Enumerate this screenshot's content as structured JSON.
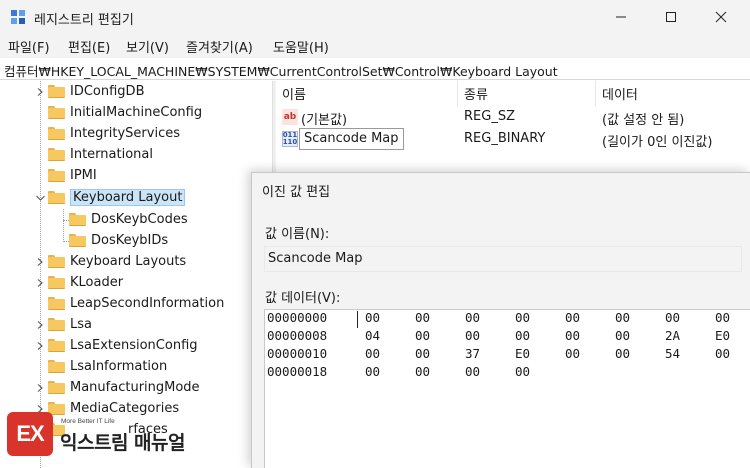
{
  "window": {
    "title": "레지스트리 편집기"
  },
  "menu": [
    "파일(F)",
    "편집(E)",
    "보기(V)",
    "즐겨찾기(A)",
    "도움말(H)"
  ],
  "address": "컴퓨터₩HKEY_LOCAL_MACHINE₩SYSTEM₩CurrentControlSet₩Control₩Keyboard Layout",
  "tree": {
    "items": [
      {
        "label": "IDConfigDB",
        "expandable": true
      },
      {
        "label": "InitialMachineConfig",
        "expandable": false
      },
      {
        "label": "IntegrityServices",
        "expandable": false
      },
      {
        "label": "International",
        "expandable": false
      },
      {
        "label": "IPMI",
        "expandable": false
      },
      {
        "label": "Keyboard Layout",
        "expandable": true,
        "expanded": true,
        "selected": true
      },
      {
        "label": "DosKeybCodes",
        "expandable": false,
        "child": true
      },
      {
        "label": "DosKeybIDs",
        "expandable": false,
        "child": true
      },
      {
        "label": "Keyboard Layouts",
        "expandable": true
      },
      {
        "label": "KLoader",
        "expandable": true
      },
      {
        "label": "LeapSecondInformation",
        "expandable": false
      },
      {
        "label": "Lsa",
        "expandable": true
      },
      {
        "label": "LsaExtensionConfig",
        "expandable": true
      },
      {
        "label": "LsaInformation",
        "expandable": false
      },
      {
        "label": "ManufacturingMode",
        "expandable": true
      },
      {
        "label": "MediaCategories",
        "expandable": true
      },
      {
        "label": "rfaces",
        "expandable": false
      }
    ]
  },
  "list": {
    "columns": [
      "이름",
      "종류",
      "데이터"
    ],
    "rows": [
      {
        "name": "(기본값)",
        "type": "REG_SZ",
        "data": "(값 설정 안 됨)",
        "icon": "string-value-icon"
      },
      {
        "name": "Scancode Map",
        "type": "REG_BINARY",
        "data": "(길이가 0인 이진값)",
        "icon": "binary-value-icon"
      }
    ]
  },
  "dialog": {
    "title": "이진 값 편집",
    "name_label": "값 이름(N):",
    "name_value": "Scancode Map",
    "data_label": "값 데이터(V):",
    "hex_rows": [
      {
        "addr": "00000000",
        "bytes": [
          "00",
          "00",
          "00",
          "00",
          "00",
          "00",
          "00",
          "00"
        ]
      },
      {
        "addr": "00000008",
        "bytes": [
          "04",
          "00",
          "00",
          "00",
          "00",
          "00",
          "2A",
          "E0"
        ]
      },
      {
        "addr": "00000010",
        "bytes": [
          "00",
          "00",
          "37",
          "E0",
          "00",
          "00",
          "54",
          "00"
        ]
      },
      {
        "addr": "00000018",
        "bytes": [
          "00",
          "00",
          "00",
          "00",
          "",
          "",
          "",
          ""
        ]
      }
    ]
  },
  "watermark": {
    "logo": "EX",
    "tagline": "More Better IT Life",
    "name": "익스트림 매뉴얼"
  }
}
